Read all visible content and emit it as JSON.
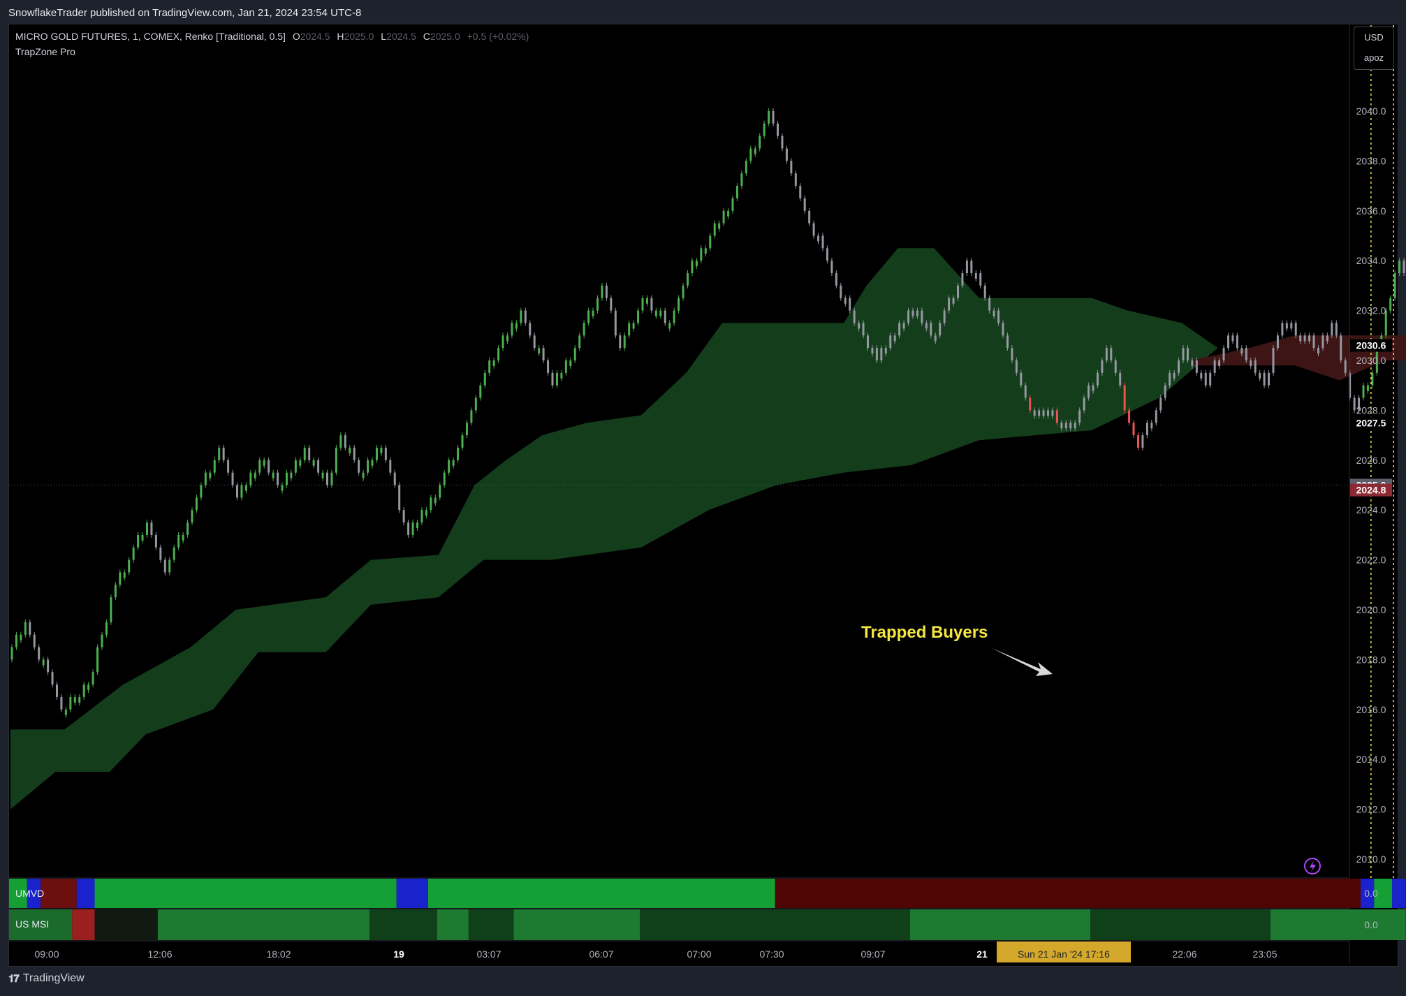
{
  "header": {
    "published_line": "SnowflakeTrader published on TradingView.com, Jan 21, 2024 23:54 UTC-8"
  },
  "legend": {
    "symbol": "MICRO GOLD FUTURES, 1, COMEX, Renko [Traditional, 0.5]",
    "o_label": "O",
    "o_value": "2024.5",
    "h_label": "H",
    "h_value": "2025.0",
    "l_label": "L",
    "l_value": "2024.5",
    "c_label": "C",
    "c_value": "2025.0",
    "change": "+0.5 (+0.02%)",
    "indicator": "TrapZone Pro"
  },
  "currency_box": {
    "currency": "USD",
    "label": "apoz"
  },
  "annotation": {
    "text": "Trapped Buyers"
  },
  "panes": {
    "umvd": {
      "label": "UMVD",
      "value": "0.0"
    },
    "usmsi": {
      "label": "US MSI",
      "value": "0.0"
    }
  },
  "crosshair_date": "Sun 21 Jan '24  17:16",
  "footer": {
    "brand": "TradingView",
    "logo": "tradingview-logo-icon"
  },
  "colors": {
    "up": "#4caf50",
    "neutral": "#9598a1",
    "down": "#ef5350",
    "bull_zone": "#143d1c",
    "bear_zone": "#3d1515",
    "yellow": "#f5e642",
    "highlight_box": "#d4a82a"
  },
  "chart_data": {
    "type": "renko",
    "ylim": [
      2009,
      2043
    ],
    "yticks": [
      "2040.0",
      "2038.0",
      "2036.0",
      "2034.0",
      "2032.0",
      "2030.0",
      "2028.0",
      "2026.0",
      "2024.0",
      "2022.0",
      "2020.0",
      "2018.0",
      "2016.0",
      "2014.0",
      "2012.0",
      "2010.0"
    ],
    "price_labels": [
      {
        "value": "2030.6",
        "bg": "#000000",
        "fg": "#ffffff"
      },
      {
        "value": "2027.5",
        "bg": "#000000",
        "fg": "#ffffff"
      },
      {
        "value": "2025.0",
        "bg": "#5d606b",
        "fg": "#ffffff"
      },
      {
        "value": "2024.8",
        "bg": "#8b2a33",
        "fg": "#ffffff"
      }
    ],
    "last_price": 2025.0,
    "xticks": [
      "09:00",
      "12:06",
      "18:02",
      "19",
      "03:07",
      "06:07",
      "07:00",
      "07:30",
      "09:07",
      "21",
      "22:06",
      "23:05"
    ],
    "bars": 300,
    "path_pivots": [
      [
        0,
        2018.5
      ],
      [
        3,
        2019.5
      ],
      [
        11,
        2016
      ],
      [
        17,
        2017
      ],
      [
        23,
        2021
      ],
      [
        30,
        2023.5
      ],
      [
        34,
        2021.5
      ],
      [
        40,
        2024
      ],
      [
        46,
        2026.5
      ],
      [
        50,
        2024.5
      ],
      [
        55,
        2026
      ],
      [
        60,
        2025
      ],
      [
        65,
        2026.5
      ],
      [
        70,
        2025
      ],
      [
        73,
        2027
      ],
      [
        77,
        2025.5
      ],
      [
        82,
        2026.5
      ],
      [
        88,
        2023
      ],
      [
        95,
        2025
      ],
      [
        100,
        2027
      ],
      [
        105,
        2029.5
      ],
      [
        113,
        2032
      ],
      [
        120,
        2029
      ],
      [
        125,
        2030.5
      ],
      [
        131,
        2033
      ],
      [
        135,
        2030.5
      ],
      [
        140,
        2032.5
      ],
      [
        146,
        2031.5
      ],
      [
        150,
        2033.5
      ],
      [
        160,
        2036.5
      ],
      [
        168,
        2040
      ],
      [
        175,
        2036.5
      ],
      [
        183,
        2033
      ],
      [
        192,
        2030
      ],
      [
        200,
        2032
      ],
      [
        205,
        2031
      ],
      [
        212,
        2034
      ],
      [
        220,
        2031
      ],
      [
        226,
        2028
      ],
      [
        236,
        2027.5
      ],
      [
        243,
        2030.5
      ],
      [
        250,
        2026.5
      ],
      [
        260,
        2030.5
      ],
      [
        265,
        2029
      ],
      [
        270,
        2031
      ],
      [
        278,
        2029
      ],
      [
        282,
        2031.5
      ],
      [
        290,
        2030.5
      ],
      [
        293,
        2031.5
      ],
      [
        298,
        2028
      ],
      [
        302,
        2029.5
      ],
      [
        308,
        2034
      ],
      [
        315,
        2031
      ],
      [
        320,
        2029
      ],
      [
        333,
        2023.5
      ],
      [
        339,
        2025.5
      ],
      [
        346,
        2022.5
      ],
      [
        352,
        2025.5
      ],
      [
        360,
        2021
      ],
      [
        367,
        2025.5
      ],
      [
        374,
        2024.5
      ]
    ],
    "bull_zone_upper": [
      [
        0,
        2015.2
      ],
      [
        12,
        2015.2
      ],
      [
        25,
        2017
      ],
      [
        40,
        2018.5
      ],
      [
        50,
        2020
      ],
      [
        70,
        2020.5
      ],
      [
        80,
        2022
      ],
      [
        95,
        2022.2
      ],
      [
        103,
        2025
      ],
      [
        110,
        2026
      ],
      [
        118,
        2027
      ],
      [
        128,
        2027.5
      ],
      [
        140,
        2027.8
      ],
      [
        150,
        2029.5
      ],
      [
        158,
        2031.5
      ],
      [
        175,
        2031.5
      ],
      [
        185,
        2031.5
      ],
      [
        190,
        2033
      ],
      [
        197,
        2034.5
      ],
      [
        205,
        2034.5
      ],
      [
        215,
        2032.5
      ],
      [
        240,
        2032.5
      ],
      [
        248,
        2032
      ],
      [
        260,
        2031.5
      ],
      [
        268,
        2030.5
      ]
    ],
    "bull_zone_lower": [
      [
        0,
        2012
      ],
      [
        10,
        2013.5
      ],
      [
        22,
        2013.5
      ],
      [
        30,
        2015
      ],
      [
        45,
        2016
      ],
      [
        55,
        2018.3
      ],
      [
        70,
        2018.3
      ],
      [
        80,
        2020.2
      ],
      [
        95,
        2020.5
      ],
      [
        105,
        2022
      ],
      [
        120,
        2022
      ],
      [
        140,
        2022.5
      ],
      [
        155,
        2024
      ],
      [
        170,
        2025
      ],
      [
        185,
        2025.5
      ],
      [
        200,
        2025.8
      ],
      [
        215,
        2026.8
      ],
      [
        240,
        2027.2
      ],
      [
        255,
        2028.5
      ],
      [
        268,
        2030.5
      ]
    ],
    "bear_zone_upper": [
      [
        262,
        2030
      ],
      [
        275,
        2030.5
      ],
      [
        285,
        2031
      ],
      [
        330,
        2031
      ],
      [
        335,
        2031.5
      ],
      [
        340,
        2031
      ],
      [
        355,
        2030.5
      ],
      [
        374,
        2030.5
      ]
    ],
    "bear_zone_lower": [
      [
        262,
        2029.8
      ],
      [
        285,
        2029.8
      ],
      [
        295,
        2029.2
      ],
      [
        305,
        2030
      ],
      [
        325,
        2030
      ],
      [
        333,
        2028.5
      ],
      [
        355,
        2028
      ],
      [
        374,
        2027.5
      ]
    ],
    "vertical_markers": [
      302,
      307
    ],
    "umvd_segments": [
      [
        "#15a036",
        0,
        4
      ],
      [
        "#1a22cc",
        4,
        7
      ],
      [
        "#6b0f0f",
        7,
        15
      ],
      [
        "#1a22cc",
        15,
        19
      ],
      [
        "#15a036",
        19,
        86
      ],
      [
        "#1a22cc",
        86,
        93
      ],
      [
        "#15a036",
        93,
        170
      ],
      [
        "#500505",
        170,
        300
      ],
      [
        "#1a22cc",
        300,
        303
      ],
      [
        "#15a036",
        303,
        307
      ],
      [
        "#1a22cc",
        307,
        310
      ],
      [
        "#500505",
        310,
        366
      ],
      [
        "#1a22cc",
        366,
        368
      ],
      [
        "#15a036",
        368,
        375
      ]
    ],
    "usmsi_segments": [
      [
        "#1b6b2c",
        0,
        14
      ],
      [
        "#9a2020",
        14,
        19
      ],
      [
        "#111a11",
        19,
        33
      ],
      [
        "#1e7a30",
        33,
        80
      ],
      [
        "#10401a",
        80,
        95
      ],
      [
        "#1e7a30",
        95,
        102
      ],
      [
        "#10401a",
        102,
        112
      ],
      [
        "#1e7a30",
        112,
        140
      ],
      [
        "#10401a",
        140,
        200
      ],
      [
        "#1e7a30",
        200,
        240
      ],
      [
        "#10401a",
        240,
        280
      ],
      [
        "#1e7a30",
        280,
        310
      ],
      [
        "#10401a",
        310,
        325
      ],
      [
        "#1e7a30",
        325,
        332
      ],
      [
        "#10401a",
        332,
        375
      ]
    ]
  }
}
